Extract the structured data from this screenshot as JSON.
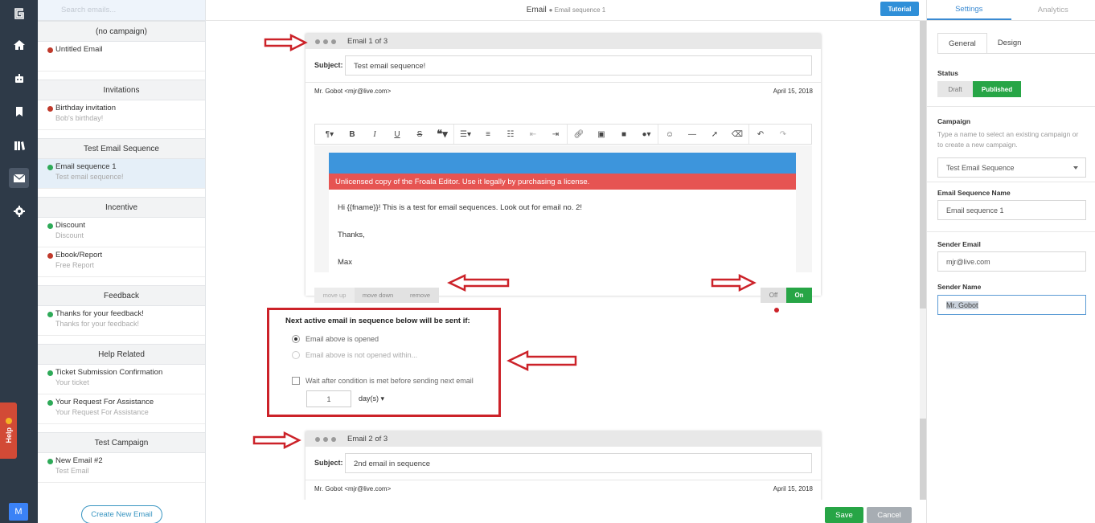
{
  "search": {
    "placeholder": "Search emails..."
  },
  "groups": [
    {
      "name": "(no campaign)",
      "items": [
        {
          "title": "Untitled Email",
          "sub": "",
          "status": "red"
        }
      ]
    },
    {
      "name": "Invitations",
      "items": [
        {
          "title": "Birthday invitation",
          "sub": "Bob's birthday!",
          "status": "red"
        }
      ]
    },
    {
      "name": "Test Email Sequence",
      "items": [
        {
          "title": "Email sequence 1",
          "sub": "Test email sequence!",
          "status": "green"
        }
      ]
    },
    {
      "name": "Incentive",
      "items": [
        {
          "title": "Discount",
          "sub": "Discount",
          "status": "green"
        },
        {
          "title": "Ebook/Report",
          "sub": "Free Report",
          "status": "red"
        }
      ]
    },
    {
      "name": "Feedback",
      "items": [
        {
          "title": "Thanks for your feedback!",
          "sub": "Thanks for your feedback!",
          "status": "green"
        }
      ]
    },
    {
      "name": "Help Related",
      "items": [
        {
          "title": "Ticket Submission Confirmation",
          "sub": "Your ticket",
          "status": "green"
        },
        {
          "title": "Your Request For Assistance",
          "sub": "Your Request For Assistance",
          "status": "green"
        }
      ]
    },
    {
      "name": "Test Campaign",
      "items": [
        {
          "title": "New Email #2",
          "sub": "Test Email",
          "status": "green"
        }
      ]
    }
  ],
  "create_new_label": "Create New Email",
  "help_label": "Help",
  "user_initial": "M",
  "topbar": {
    "title": "Email",
    "subtitle": "Email sequence 1",
    "tutorial": "Tutorial"
  },
  "email1": {
    "title": "Email 1 of 3",
    "subject_label": "Subject:",
    "subject": "Test email sequence!",
    "from": "Mr. Gobot <mjr@live.com>",
    "date": "April 15, 2018",
    "license": "Unlicensed copy of the Froala Editor. Use it legally by purchasing a license.",
    "body1": "Hi {{fname}}!  This is a test for email sequences.  Look out for email no. 2!",
    "body2": "Thanks,",
    "body3": "Max",
    "move_up": "move up",
    "move_down": "move down",
    "remove": "remove",
    "off": "Off",
    "on": "On"
  },
  "condition": {
    "heading": "Next active email in sequence below will be sent if:",
    "opt1": "Email above is opened",
    "opt2": "Email above is not opened within...",
    "wait": "Wait after condition is met before sending next email",
    "days_value": "1",
    "days_unit": "day(s)"
  },
  "email2": {
    "title": "Email 2 of 3",
    "subject_label": "Subject:",
    "subject": "2nd email in sequence",
    "from": "Mr. Gobot <mjr@live.com>",
    "date": "April 15, 2018"
  },
  "bottom": {
    "save": "Save",
    "cancel": "Cancel"
  },
  "right": {
    "tab_settings": "Settings",
    "tab_analytics": "Analytics",
    "sub_general": "General",
    "sub_design": "Design",
    "status_label": "Status",
    "draft": "Draft",
    "published": "Published",
    "campaign_label": "Campaign",
    "campaign_desc": "Type a name to select an existing campaign or to create a new campaign.",
    "campaign_value": "Test Email Sequence",
    "seqname_label": "Email Sequence Name",
    "seqname_value": "Email sequence 1",
    "sender_email_label": "Sender Email",
    "sender_email_value": "mjr@live.com",
    "sender_name_label": "Sender Name",
    "sender_name_value": "Mr. Gobot"
  },
  "colors": {
    "accent": "#3a8ad2",
    "green": "#27a546",
    "annotation_red": "#cc2229",
    "sidebar": "#2e3a48"
  }
}
